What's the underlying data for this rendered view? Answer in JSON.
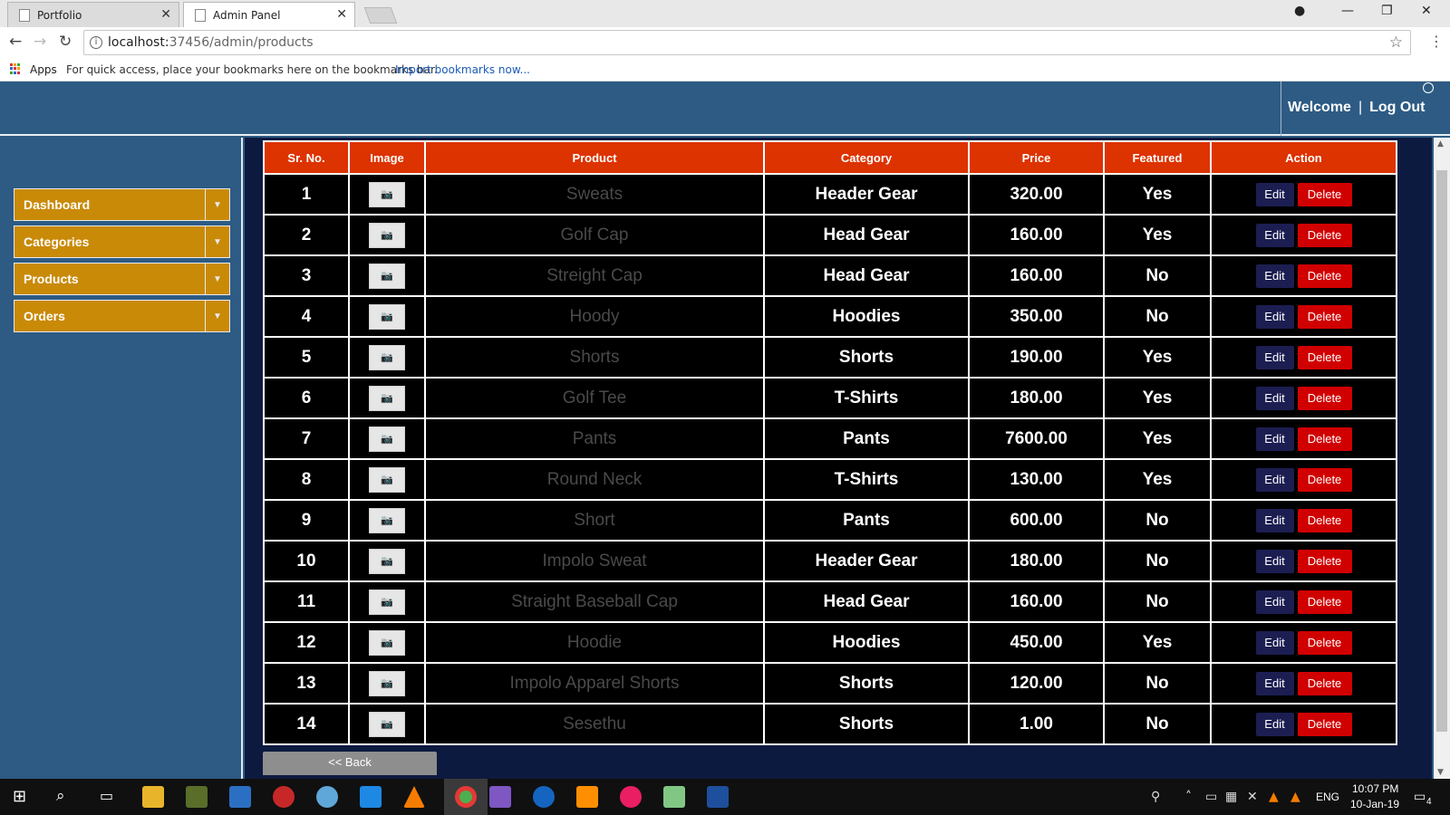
{
  "browser": {
    "tabs": [
      {
        "title": "Portfolio"
      },
      {
        "title": "Admin Panel"
      }
    ],
    "url_host": "localhost:",
    "url_rest": "37456/admin/products",
    "bookmarks": {
      "apps_label": "Apps",
      "hint": "For quick access, place your bookmarks here on the bookmarks bar.",
      "import_link": "Import bookmarks now..."
    }
  },
  "header": {
    "welcome": "Welcome",
    "separator": "|",
    "logout": "Log Out"
  },
  "sidebar": {
    "items": [
      {
        "label": "Dashboard"
      },
      {
        "label": "Categories"
      },
      {
        "label": "Products"
      },
      {
        "label": "Orders"
      }
    ]
  },
  "table": {
    "headers": [
      "Sr. No.",
      "Image",
      "Product",
      "Category",
      "Price",
      "Featured",
      "Action"
    ],
    "rows": [
      {
        "sr": "1",
        "product": "Sweats",
        "category": "Header Gear",
        "price": "320.00",
        "featured": "Yes"
      },
      {
        "sr": "2",
        "product": "Golf Cap",
        "category": "Head Gear",
        "price": "160.00",
        "featured": "Yes"
      },
      {
        "sr": "3",
        "product": "Streight Cap",
        "category": "Head Gear",
        "price": "160.00",
        "featured": "No"
      },
      {
        "sr": "4",
        "product": "Hoody",
        "category": "Hoodies",
        "price": "350.00",
        "featured": "No"
      },
      {
        "sr": "5",
        "product": "Shorts",
        "category": "Shorts",
        "price": "190.00",
        "featured": "Yes"
      },
      {
        "sr": "6",
        "product": "Golf Tee",
        "category": "T-Shirts",
        "price": "180.00",
        "featured": "Yes"
      },
      {
        "sr": "7",
        "product": "Pants",
        "category": "Pants",
        "price": "7600.00",
        "featured": "Yes"
      },
      {
        "sr": "8",
        "product": "Round Neck",
        "category": "T-Shirts",
        "price": "130.00",
        "featured": "Yes"
      },
      {
        "sr": "9",
        "product": "Short",
        "category": "Pants",
        "price": "600.00",
        "featured": "No"
      },
      {
        "sr": "10",
        "product": "Impolo Sweat",
        "category": "Header Gear",
        "price": "180.00",
        "featured": "No"
      },
      {
        "sr": "11",
        "product": "Straight Baseball Cap",
        "category": "Head Gear",
        "price": "160.00",
        "featured": "No"
      },
      {
        "sr": "12",
        "product": "Hoodie",
        "category": "Hoodies",
        "price": "450.00",
        "featured": "Yes"
      },
      {
        "sr": "13",
        "product": "Impolo Apparel Shorts",
        "category": "Shorts",
        "price": "120.00",
        "featured": "No"
      },
      {
        "sr": "14",
        "product": "Sesethu",
        "category": "Shorts",
        "price": "1.00",
        "featured": "No"
      }
    ],
    "edit_label": "Edit",
    "delete_label": "Delete"
  },
  "back_button": "<< Back",
  "taskbar": {
    "language": "ENG",
    "time": "10:07 PM",
    "date": "10-Jan-19",
    "notification_count": "4"
  },
  "colors": {
    "header_bg": "#2d5b84",
    "sidebar_item": "#c98a08",
    "table_header": "#dd3300",
    "content_bg": "#0d1a40",
    "edit_button": "#1c1e52",
    "delete_button": "#d10000"
  }
}
